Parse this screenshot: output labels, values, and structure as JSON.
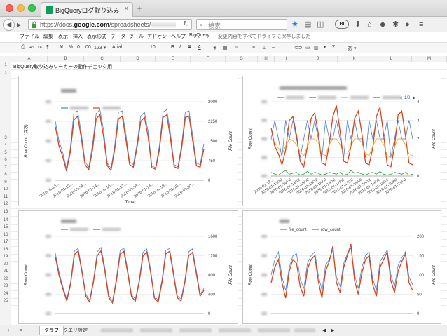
{
  "browser": {
    "tab_title": "BigQueryログ取り込みレポ…",
    "tab_close": "×",
    "new_tab": "+",
    "url_prefix": "https://docs.",
    "url_domain": "google.com",
    "url_suffix": "/spreadsheets/",
    "search_placeholder": "検索",
    "profile_badge": "BI",
    "colors": {
      "accent": "#3a7bd5",
      "favicon": "#0f9d58"
    }
  },
  "menubar": {
    "items": [
      "ファイル",
      "編集",
      "表示",
      "挿入",
      "表示形式",
      "データ",
      "ツール",
      "アドオン",
      "ヘルプ",
      "BigQuery"
    ],
    "save_status": "変更内容をすべてドライブに保存しました"
  },
  "toolbar": {
    "percent": "%",
    "decimals_less": ".0",
    "decimals_more": ".00",
    "number_format": "123 ▾",
    "font": "Arial",
    "font_size": "10",
    "bold": "B",
    "italic": "I",
    "strike": "S",
    "text_color": "A",
    "more": "あ ▾"
  },
  "sheet": {
    "columns": [
      "A",
      "B",
      "C",
      "D",
      "E",
      "F",
      "G",
      "H",
      "I",
      "J",
      "K",
      "L",
      "M"
    ],
    "rows": [
      "1",
      "2",
      "3",
      "4",
      "5",
      "6",
      "7",
      "8",
      "9",
      "10",
      "11",
      "12",
      "13",
      "14",
      "15",
      "16",
      "17",
      "18",
      "19",
      "20",
      "21",
      "22",
      "23",
      "24",
      "25"
    ],
    "a1_text": "BigQuery取り込みワーカーの動作チェック用"
  },
  "sheet_tabs": {
    "add": "+",
    "list": "≡",
    "tabs": [
      "グラフ",
      "クエリ設定"
    ]
  },
  "chart_data": [
    {
      "type": "line",
      "ylabel": "Row Count (百万)",
      "y2label": "File Count",
      "xlabel": "Time",
      "y2_ticks": [
        "3000",
        "2250",
        "1500",
        "750",
        "0"
      ],
      "x_ticks": [
        "2016-01-13...",
        "2016-01-13...",
        "2016-01-14...",
        "2016-01-14...",
        "2016-01-16...",
        "2016-01-17...",
        "2016-01-18...",
        "2016-01-18...",
        "2016-01-19...",
        "2016-01-19...",
        "2016-01-20..."
      ],
      "y2lim": [
        0,
        3000
      ],
      "series": [
        {
          "color": "#4a7fd4",
          "values": [
            2250,
            1500,
            1050,
            450,
            1200,
            2600,
            2650,
            1800,
            700,
            500,
            1350,
            2550,
            2700,
            1900,
            650,
            450,
            1350,
            2600,
            2650,
            1750,
            700,
            600,
            1400,
            2450,
            2600,
            1850,
            550,
            480,
            1300,
            2600,
            2700,
            1800,
            600,
            520,
            1350,
            2600,
            2650,
            1700,
            650,
            600,
            1400
          ]
        },
        {
          "color": "#d2461f",
          "values": [
            2050,
            1300,
            900,
            350,
            1050,
            2300,
            2450,
            1600,
            600,
            400,
            1150,
            2350,
            2500,
            1650,
            550,
            380,
            1200,
            2350,
            2450,
            1550,
            600,
            500,
            1250,
            2250,
            2400,
            1650,
            480,
            420,
            1150,
            2400,
            2500,
            1600,
            520,
            450,
            1200,
            2400,
            2450,
            1500,
            550,
            500,
            1200
          ]
        }
      ]
    },
    {
      "type": "line",
      "ylabel": "Row Count",
      "y2label": "File Count",
      "legend_page": "1/2",
      "y2_ticks": [
        "4",
        "3",
        "2",
        "1",
        "0"
      ],
      "x_ticks": [
        "2016-01-13...",
        "2016-01-13/18",
        "2016-01-14/06",
        "2016-01-14/18",
        "2016-01-15/06",
        "2016-01-15/18",
        "2016-01-16/06",
        "2016-01-16/18",
        "2016-01-17/06",
        "2016-01-17/18",
        "2016-01-18/06",
        "2016-01-18/18",
        "2016-01-19/06",
        "2016-01-19/18",
        "2016-01-20/06",
        "2016-01-21/00"
      ],
      "y2lim": [
        0,
        4
      ],
      "series": [
        {
          "color": "#4a7fd4",
          "values": [
            2,
            3,
            2,
            1,
            3,
            2,
            3,
            2,
            1,
            2,
            3,
            2,
            3,
            2,
            1,
            3,
            2,
            2,
            3,
            2,
            1,
            3,
            2,
            3,
            2,
            2,
            1,
            3,
            2,
            3,
            2,
            2,
            3,
            1,
            2,
            3,
            2,
            2,
            3,
            2
          ]
        },
        {
          "color": "#d2461f",
          "values": [
            2.6,
            1.6,
            1.2,
            0.6,
            1.4,
            3.0,
            3.2,
            2.2,
            0.8,
            0.5,
            1.6,
            3.1,
            3.4,
            2.3,
            0.7,
            0.6,
            1.7,
            3.2,
            3.8,
            2.4,
            0.8,
            0.7,
            1.6,
            3.1,
            3.5,
            2.3,
            0.7,
            0.6,
            1.5,
            3.2,
            3.7,
            2.2,
            0.6,
            0.5,
            1.6,
            3.3,
            3.5,
            2.2,
            0.7,
            0.6
          ]
        },
        {
          "color": "#f0a020",
          "values": [
            2.0,
            1.8,
            1.5,
            1.2,
            1.6,
            2.0,
            1.9,
            1.7,
            1.3,
            1.1,
            1.6,
            2.0,
            2.0,
            1.8,
            1.2,
            1.1,
            1.7,
            2.0,
            2.0,
            1.7,
            1.2,
            1.2,
            1.6,
            2.0,
            2.0,
            1.8,
            1.2,
            1.1,
            1.6,
            2.0,
            2.0,
            1.7,
            1.1,
            1.0,
            1.6,
            2.0,
            2.0,
            1.7,
            1.2,
            1.1
          ]
        },
        {
          "color": "#1e9a2e",
          "values": [
            0.2,
            0.1,
            0.05,
            0.2,
            0.3,
            0.1,
            0.15,
            0.2,
            0.05,
            0.1,
            0.25,
            0.1,
            0.2,
            0.15,
            0.05,
            0.1,
            0.2,
            0.15,
            0.1,
            0.2,
            0.05,
            0.1,
            0.3,
            0.15,
            0.2,
            0.1,
            0.05,
            0.15,
            0.2,
            0.1,
            0.25,
            0.1,
            0.05,
            0.1,
            0.2,
            0.15,
            0.1,
            0.2,
            0.05,
            0.1
          ]
        }
      ]
    },
    {
      "type": "line",
      "ylabel": "Row Count",
      "y2label": "File Count",
      "y2_ticks": [
        "1600",
        "1200",
        "800",
        "400",
        "0"
      ],
      "y2lim": [
        0,
        1600
      ],
      "series": [
        {
          "color": "#4a7fd4",
          "values": [
            1250,
            850,
            550,
            300,
            650,
            1300,
            1350,
            900,
            400,
            280,
            700,
            1280,
            1370,
            950,
            380,
            260,
            720,
            1300,
            1360,
            900,
            390,
            300,
            690,
            1270,
            1340,
            920,
            360,
            280,
            700,
            1310,
            1350,
            880,
            370,
            300,
            690,
            1280,
            1340,
            900,
            400,
            520
          ]
        },
        {
          "color": "#d2461f",
          "values": [
            1180,
            780,
            500,
            260,
            600,
            1220,
            1300,
            850,
            360,
            240,
            650,
            1200,
            1300,
            880,
            340,
            220,
            660,
            1230,
            1290,
            840,
            350,
            260,
            640,
            1190,
            1280,
            860,
            320,
            240,
            640,
            1240,
            1290,
            820,
            330,
            260,
            640,
            1200,
            1270,
            840,
            360,
            480
          ]
        }
      ]
    },
    {
      "type": "line",
      "ylabel": "Row Count",
      "y2label": "File Count",
      "y2_ticks": [
        "200",
        "150",
        "100",
        "50",
        "0"
      ],
      "y2lim": [
        0,
        200
      ],
      "series": [
        {
          "name": "file_count",
          "color": "#4a7fd4",
          "values": [
            100,
            140,
            160,
            95,
            60,
            120,
            150,
            155,
            90,
            65,
            130,
            150,
            160,
            100,
            60,
            125,
            140,
            165,
            95,
            70,
            130,
            155,
            170,
            100,
            65,
            120,
            150,
            160,
            90,
            60,
            135,
            150,
            165,
            100,
            70,
            125,
            145,
            160,
            95,
            75
          ]
        },
        {
          "name": "row_count",
          "color": "#d2461f",
          "values": [
            80,
            120,
            140,
            80,
            40,
            110,
            140,
            130,
            70,
            45,
            115,
            140,
            150,
            85,
            40,
            110,
            135,
            175,
            80,
            55,
            120,
            150,
            180,
            85,
            50,
            105,
            140,
            150,
            75,
            45,
            120,
            140,
            160,
            85,
            55,
            110,
            135,
            155,
            80,
            60
          ]
        }
      ]
    }
  ]
}
